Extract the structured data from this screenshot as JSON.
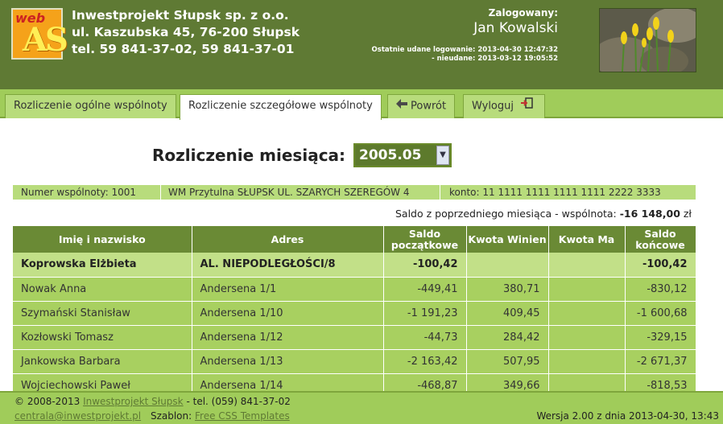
{
  "header": {
    "logo_top": "web",
    "logo_main": "AS",
    "company_name": "Inwestprojekt Słupsk sp. z o.o.",
    "company_address": "ul. Kaszubska 45, 76-200 Słupsk",
    "company_phone": "tel. 59 841-37-02, 59 841-37-01",
    "logged_label": "Zalogowany:",
    "user_name": "Jan Kowalski",
    "last_login": "Ostatnie udane logowanie: 2013-04-30 12:47:32",
    "last_failed": "- nieudane: 2013-03-12 19:05:52"
  },
  "tabs": [
    {
      "label": "Rozliczenie ogólne wspólnoty"
    },
    {
      "label": "Rozliczenie szczegółowe wspólnoty"
    },
    {
      "label": "Powrót",
      "icon": "arrow-left-icon"
    },
    {
      "label": "Wyloguj",
      "icon": "logout-icon"
    }
  ],
  "month": {
    "label": "Rozliczenie miesiąca:",
    "selected": "2005.05"
  },
  "community": {
    "number": "Numer wspólnoty: 1001",
    "name": "WM Przytulna SŁUPSK UL. SZARYCH SZEREGÓW 4",
    "account": "konto:  11 1111 1111 1111 1111 2222 3333"
  },
  "previous_balance": {
    "label": "Saldo z poprzedniego miesiąca - wspólnota:",
    "value": "-16 148,00",
    "unit": "zł"
  },
  "table": {
    "headers": [
      "Imię i nazwisko",
      "Adres",
      "Saldo początkowe",
      "Kwota Winien",
      "Kwota Ma",
      "Saldo końcowe"
    ],
    "rows": [
      {
        "name": "Koprowska Elżbieta",
        "address": "AL. NIEPODLEGŁOŚCI/8",
        "start": "-100,42",
        "debit": "",
        "credit": "",
        "end": "-100,42"
      },
      {
        "name": "Nowak Anna",
        "address": "Andersena 1/1",
        "start": "-449,41",
        "debit": "380,71",
        "credit": "",
        "end": "-830,12"
      },
      {
        "name": "Szymański Stanisław",
        "address": "Andersena 1/10",
        "start": "-1 191,23",
        "debit": "409,45",
        "credit": "",
        "end": "-1 600,68"
      },
      {
        "name": "Kozłowski Tomasz",
        "address": "Andersena 1/12",
        "start": "-44,73",
        "debit": "284,42",
        "credit": "",
        "end": "-329,15"
      },
      {
        "name": "Jankowska Barbara",
        "address": "Andersena 1/13",
        "start": "-2 163,42",
        "debit": "507,95",
        "credit": "",
        "end": "-2 671,37"
      },
      {
        "name": "Wojciechowski Paweł",
        "address": "Andersena 1/14",
        "start": "-468,87",
        "debit": "349,66",
        "credit": "",
        "end": "-818,53"
      }
    ]
  },
  "footer": {
    "copyright": "© 2008-2013",
    "company_link": "Inwestprojekt Słupsk",
    "phone": "- tel. (059) 841-37-02",
    "email": "centrala@inwestprojekt.pl",
    "template_label": "Szablon:",
    "template_link": "Free CSS Templates",
    "version": "Wersja 2.00 z dnia 2013-04-30, 13:43"
  },
  "colors": {
    "header_bg": "#5f7a34",
    "tab_bar": "#a0cc5a",
    "table_header": "#6a8a35",
    "row_bg": "#a8d060"
  }
}
